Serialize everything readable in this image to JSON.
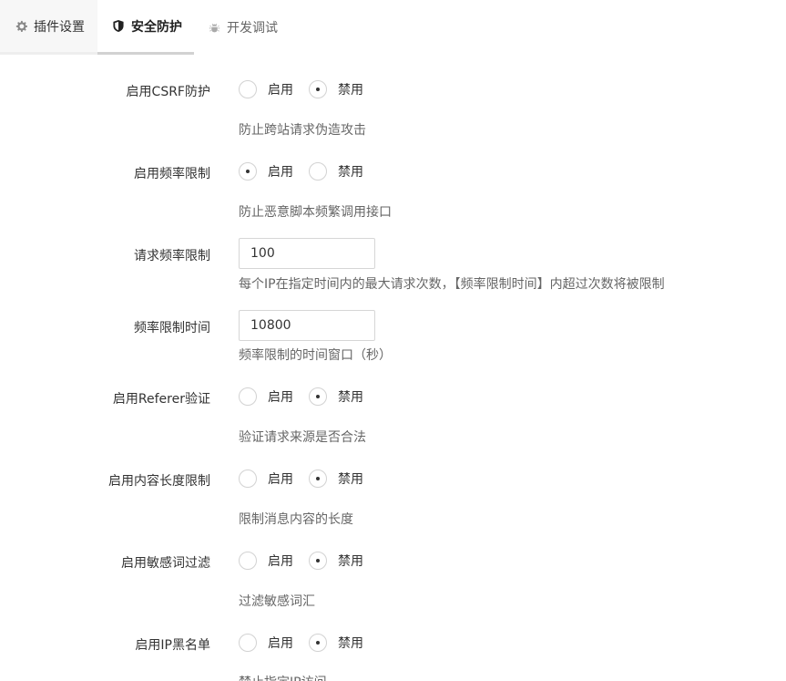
{
  "tabs": [
    {
      "label": "插件设置",
      "icon": "gear-icon"
    },
    {
      "label": "安全防护",
      "icon": "shield-icon"
    },
    {
      "label": "开发调试",
      "icon": "bug-icon"
    }
  ],
  "radio_labels": {
    "enable": "启用",
    "disable": "禁用"
  },
  "settings": {
    "csrf": {
      "label": "启用CSRF防护",
      "value": "禁用",
      "hint": "防止跨站请求伪造攻击"
    },
    "rate_limit": {
      "label": "启用频率限制",
      "value": "启用",
      "hint": "防止恶意脚本频繁调用接口"
    },
    "request_limit": {
      "label": "请求频率限制",
      "value": "100",
      "hint": "每个IP在指定时间内的最大请求次数，【频率限制时间】内超过次数将被限制"
    },
    "limit_window": {
      "label": "频率限制时间",
      "value": "10800",
      "hint": "频率限制的时间窗口（秒）"
    },
    "referer": {
      "label": "启用Referer验证",
      "value": "禁用",
      "hint": "验证请求来源是否合法"
    },
    "content_length": {
      "label": "启用内容长度限制",
      "value": "禁用",
      "hint": "限制消息内容的长度"
    },
    "sensitive_words": {
      "label": "启用敏感词过滤",
      "value": "禁用",
      "hint": "过滤敏感词汇"
    },
    "ip_blacklist": {
      "label": "启用IP黑名单",
      "value": "禁用",
      "hint": "禁止指定IP访问"
    }
  },
  "colors": {
    "tab_active_underline": "#d2d2d2",
    "radio_border": "#d2d2d2",
    "hint_text": "#666666"
  }
}
